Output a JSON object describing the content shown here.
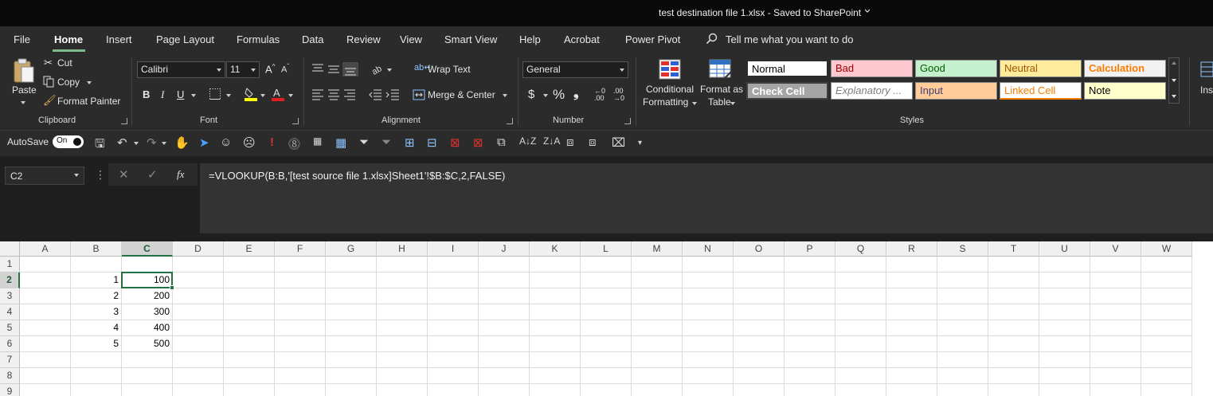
{
  "window": {
    "title": "test destination file 1.xlsx  -  Saved to SharePoint"
  },
  "menu": {
    "tabs": [
      "File",
      "Home",
      "Insert",
      "Page Layout",
      "Formulas",
      "Data",
      "Review",
      "View",
      "Smart View",
      "Help",
      "Acrobat",
      "Power Pivot"
    ],
    "active_tab": "Home",
    "tell_me": "Tell me what you want to do"
  },
  "ribbon": {
    "clipboard": {
      "paste": "Paste",
      "cut": "Cut",
      "copy": "Copy",
      "format_painter": "Format Painter",
      "group_label": "Clipboard"
    },
    "font": {
      "font_name": "Calibri",
      "font_size": "11",
      "group_label": "Font"
    },
    "alignment": {
      "wrap_text": "Wrap Text",
      "merge_center": "Merge & Center",
      "group_label": "Alignment"
    },
    "number": {
      "format": "General",
      "group_label": "Number"
    },
    "styles": {
      "conditional_formatting": [
        "Conditional",
        "Formatting"
      ],
      "format_as_table": [
        "Format as",
        "Table"
      ],
      "cells": [
        {
          "name": "Normal",
          "bg": "#ffffff",
          "fg": "#000000"
        },
        {
          "name": "Bad",
          "bg": "#ffc7ce",
          "fg": "#9c0006"
        },
        {
          "name": "Good",
          "bg": "#c6efce",
          "fg": "#006100"
        },
        {
          "name": "Neutral",
          "bg": "#ffeb9c",
          "fg": "#9c5700"
        },
        {
          "name": "Calculation",
          "bg": "#f2f2f2",
          "fg": "#fa7d00"
        },
        {
          "name": "Check Cell",
          "bg": "#a5a5a5",
          "fg": "#ffffff"
        },
        {
          "name": "Explanatory ...",
          "bg": "#ffffff",
          "fg": "#7f7f7f"
        },
        {
          "name": "Input",
          "bg": "#ffcc99",
          "fg": "#3f3f76"
        },
        {
          "name": "Linked Cell",
          "bg": "#ffffff",
          "fg": "#fa7d00"
        },
        {
          "name": "Note",
          "bg": "#ffffcc",
          "fg": "#000000"
        }
      ],
      "group_label": "Styles"
    },
    "insert_partial": "Ins"
  },
  "qat": {
    "autosave_label": "AutoSave",
    "autosave_state": "On"
  },
  "formula_bar": {
    "name_box": "C2",
    "fx": "fx",
    "formula": "=VLOOKUP(B:B,'[test source file 1.xlsx]Sheet1'!$B:$C,2,FALSE)"
  },
  "sheet": {
    "columns": [
      "A",
      "B",
      "C",
      "D",
      "E",
      "F",
      "G",
      "H",
      "I",
      "J",
      "K",
      "L",
      "M",
      "N",
      "O",
      "P",
      "Q",
      "R",
      "S",
      "T",
      "U",
      "V",
      "W"
    ],
    "rows": [
      "1",
      "2",
      "3",
      "4",
      "5",
      "6",
      "7",
      "8",
      "9"
    ],
    "selected_column": "C",
    "selected_row": "2",
    "data": {
      "B": [
        "",
        "1",
        "2",
        "3",
        "4",
        "5",
        "",
        "",
        ""
      ],
      "C": [
        "",
        "100",
        "200",
        "300",
        "400",
        "500",
        "",
        "",
        ""
      ]
    }
  }
}
